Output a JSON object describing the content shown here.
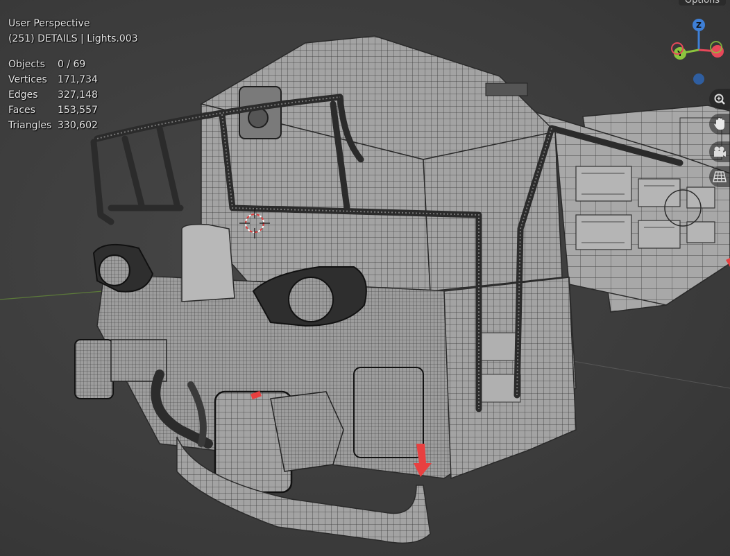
{
  "viewport": {
    "title": "User Perspective",
    "subtitle": "(251) DETAILS | Lights.003"
  },
  "stats": [
    {
      "label": "Objects",
      "value": "0 / 69"
    },
    {
      "label": "Vertices",
      "value": "171,734"
    },
    {
      "label": "Edges",
      "value": "327,148"
    },
    {
      "label": "Faces",
      "value": "153,557"
    },
    {
      "label": "Triangles",
      "value": "330,602"
    }
  ],
  "header": {
    "options_label": "Options"
  },
  "gizmo": {
    "z": "Z",
    "y": "Y"
  },
  "nav_icons": [
    "zoom-icon",
    "hand-pan-icon",
    "camera-icon",
    "grid-icon"
  ],
  "colors": {
    "background": "#3d3d3d",
    "mesh_fill": "#9a9a9a",
    "wire": "#222222",
    "axis_x": "#e8485a",
    "axis_y": "#8bc43e",
    "axis_z": "#3e7fd6",
    "selection_red": "#e84040"
  }
}
